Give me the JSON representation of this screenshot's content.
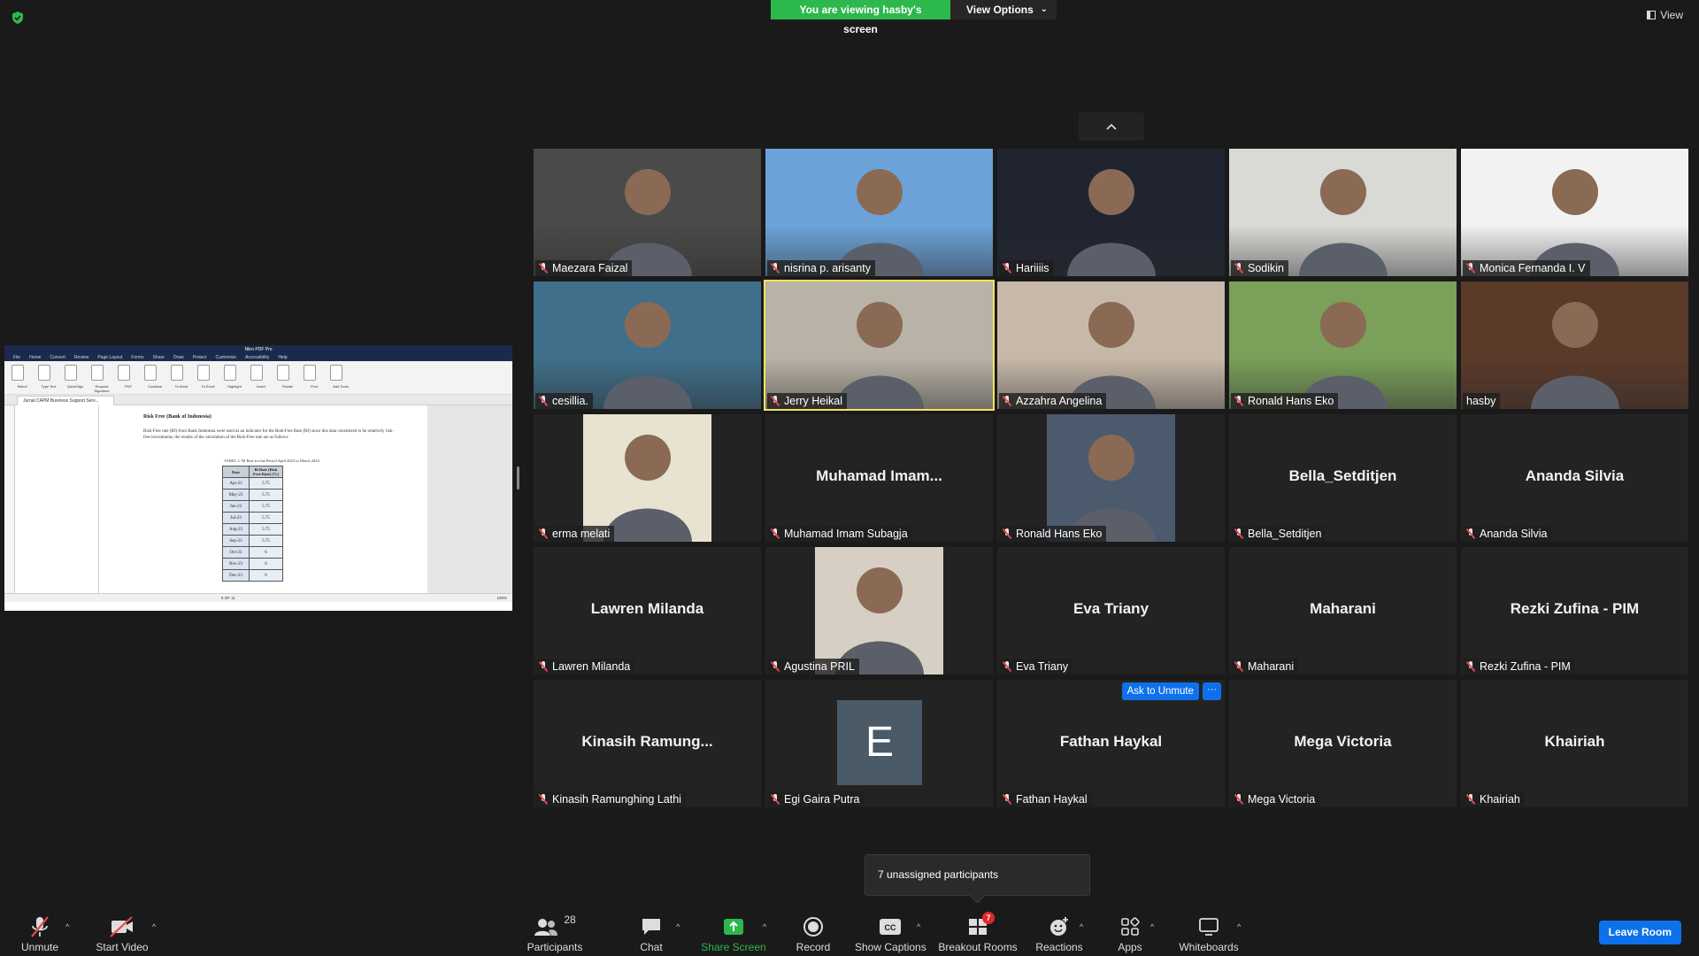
{
  "banner": {
    "sharing_text": "You are viewing hasby's screen",
    "view_options": "View Options"
  },
  "view_button": "View",
  "shared_screen": {
    "title": "Nitro PDF Pro",
    "menu": [
      "File",
      "Home",
      "Convert",
      "Review",
      "Page Layout",
      "Forms",
      "Share",
      "Draw",
      "Protect",
      "Customize",
      "Accessibility",
      "Help"
    ],
    "ribbon": [
      "Select",
      "Type Text",
      "QuickSign",
      "Request Signature",
      "PDF",
      "Combine",
      "To Word",
      "To Excel",
      "Highlight",
      "Insert",
      "Rotate",
      "Find",
      "Add Tools"
    ],
    "tab_name": "Jurnal CAPM Business Support Serv...",
    "heading": "Risk Free (Bank of Indonesia)",
    "paragraph": "Risk-Free rate (Rf) from Bank Indonesia were used as an indicator for the Risk-Free Rate (Rf) since this data considered to be relatively risk-free investments, the results of the calculation of the Risk-Free rate are as follows:",
    "caption": "TABEL 3. BI Rate for the Period April 2023 to March 2024",
    "table_headers": [
      "Date",
      "Bi Rate (Risk Free Rate) (%)"
    ],
    "table_rows": [
      [
        "Apr-23",
        "5.75"
      ],
      [
        "May-23",
        "5.75"
      ],
      [
        "Jun-23",
        "5.75"
      ],
      [
        "Jul-23",
        "5.75"
      ],
      [
        "Aug-23",
        "5.75"
      ],
      [
        "Sep-23",
        "5.75"
      ],
      [
        "Oct-23",
        "6"
      ],
      [
        "Nov-23",
        "6"
      ],
      [
        "Dec-23",
        "6"
      ]
    ],
    "page_indicator": "6 OF 11",
    "zoom": "100%"
  },
  "participants": [
    {
      "name": "Maezara Faizal",
      "video": true
    },
    {
      "name": "nisrina p. arisanty",
      "video": true
    },
    {
      "name": "Hariiiis",
      "video": true
    },
    {
      "name": "Sodikin",
      "video": true
    },
    {
      "name": "Monica Fernanda I. V",
      "video": true
    },
    {
      "name": "cesillia.",
      "video": true
    },
    {
      "name": "Jerry Heikal",
      "video": true,
      "active": true
    },
    {
      "name": "Azzahra Angelina",
      "video": true
    },
    {
      "name": "Ronald Hans Eko",
      "video": true
    },
    {
      "name": "hasby",
      "video": true,
      "unmuted": true
    },
    {
      "name": "erma melati",
      "video": true
    },
    {
      "name": "Muhamad Imam Subagja",
      "display": "Muhamad  Imam..."
    },
    {
      "name": "Ronald Hans Eko",
      "video": true
    },
    {
      "name": "Bella_Setditjen",
      "display": "Bella_Setditjen"
    },
    {
      "name": "Ananda Silvia",
      "display": "Ananda Silvia"
    },
    {
      "name": "Lawren Milanda",
      "display": "Lawren Milanda"
    },
    {
      "name": "Agustina PRIL",
      "video": true
    },
    {
      "name": "Eva Triany",
      "display": "Eva Triany"
    },
    {
      "name": "Maharani",
      "display": "Maharani"
    },
    {
      "name": "Rezki Zufina - PIM",
      "display": "Rezki Zufina - PIM"
    },
    {
      "name": "Kinasih Ramunghing Lathi",
      "display": "Kinasih  Ramung..."
    },
    {
      "name": "Egi Gaira Putra",
      "avatar_letter": "E"
    },
    {
      "name": "Fathan Haykal",
      "display": "Fathan Haykal",
      "ask_to_unmute": "Ask to Unmute",
      "more": "···"
    },
    {
      "name": "Mega Victoria",
      "display": "Mega Victoria"
    },
    {
      "name": "Khairiah",
      "display": "Khairiah"
    }
  ],
  "tooltip": "7 unassigned participants",
  "toolbar": {
    "unmute": "Unmute",
    "start_video": "Start Video",
    "participants": "Participants",
    "participants_count": "28",
    "chat": "Chat",
    "share_screen": "Share Screen",
    "record": "Record",
    "show_captions": "Show Captions",
    "breakout_rooms": "Breakout Rooms",
    "breakout_badge": "7",
    "reactions": "Reactions",
    "apps": "Apps",
    "whiteboards": "Whiteboards",
    "leave": "Leave Room"
  },
  "colors": {
    "share_green": "#2db84d",
    "accent_blue": "#0e71eb",
    "active_speaker": "#f4e45c",
    "muted_red": "#e5484d"
  }
}
